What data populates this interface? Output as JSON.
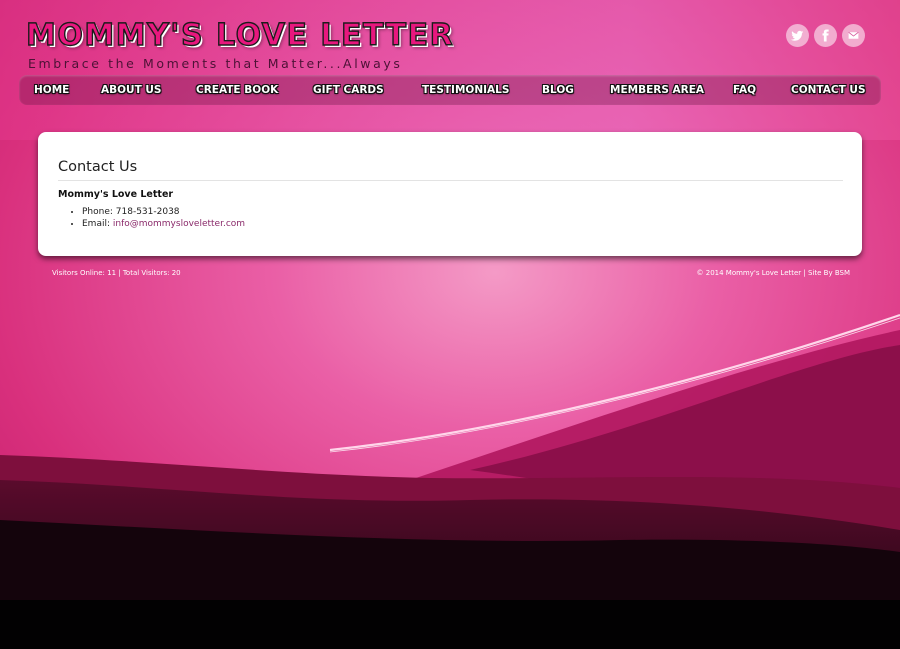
{
  "brand": {
    "title": "MOMMY'S LOVE LETTER",
    "tagline": "Embrace the Moments that Matter...Always"
  },
  "social": [
    {
      "name": "twitter",
      "icon": "twitter-icon"
    },
    {
      "name": "facebook",
      "icon": "facebook-icon"
    },
    {
      "name": "email",
      "icon": "envelope-icon"
    }
  ],
  "nav": {
    "items": [
      {
        "label": "HOME"
      },
      {
        "label": "ABOUT US"
      },
      {
        "label": "CREATE BOOK"
      },
      {
        "label": "GIFT CARDS"
      },
      {
        "label": "TESTIMONIALS"
      },
      {
        "label": "BLOG"
      },
      {
        "label": "MEMBERS AREA"
      },
      {
        "label": "FAQ"
      },
      {
        "label": "CONTACT US"
      }
    ]
  },
  "content": {
    "heading": "Contact Us",
    "business_name": "Mommy's Love Letter",
    "phone_label": "Phone: 718-531-2038",
    "email_label": "Email: ",
    "email": "info@mommysloveletter.com"
  },
  "footer": {
    "left": "Visitors Online: 11 | Total Visitors: 20",
    "right": "© 2014 Mommy's Love Letter | Site By BSM"
  },
  "colors": {
    "brand_pink": "#e8177e",
    "background_pink": "#e0337f",
    "link": "#8a2a6a"
  }
}
